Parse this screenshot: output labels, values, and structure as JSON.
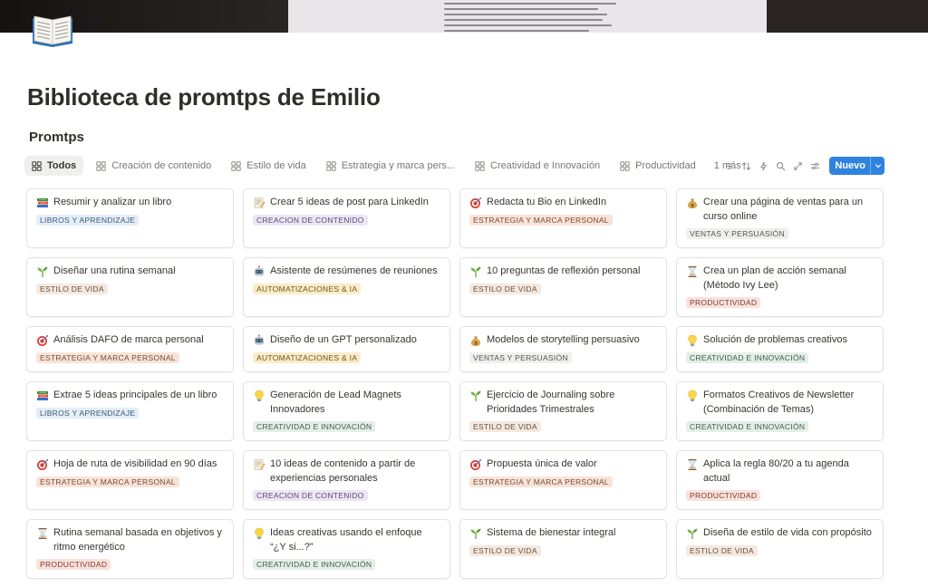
{
  "page": {
    "title": "Biblioteca de promtps de Emilio",
    "icon": "open-book-icon"
  },
  "database": {
    "title": "Promtps"
  },
  "tabs": [
    {
      "label": "Todos",
      "active": true
    },
    {
      "label": "Creación de contenido"
    },
    {
      "label": "Estilo de vida"
    },
    {
      "label": "Estrategia y marca pers..."
    },
    {
      "label": "Creatividad e Innovación"
    },
    {
      "label": "Productividad"
    }
  ],
  "tabs_more": "1 más",
  "toolbar": {
    "icons": [
      "filter-icon",
      "sort-icon",
      "lightning-icon",
      "search-icon",
      "expand-icon",
      "settings-icon"
    ],
    "new_label": "Nuevo",
    "accent": "#2f83de"
  },
  "cards": [
    {
      "emoji": "books-icon",
      "title": "Resumir y analizar un libro",
      "tag": "LIBROS Y APRENDIZAJE",
      "tag_color": "blue"
    },
    {
      "emoji": "memo-icon",
      "title": "Crear 5 ideas de post para LinkedIn",
      "tag": "CREACION DE CONTENIDO",
      "tag_color": "purple"
    },
    {
      "emoji": "target-icon",
      "title": "Redacta tu Bio en LinkedIn",
      "tag": "ESTRATEGIA Y MARCA PERSONAL",
      "tag_color": "orange"
    },
    {
      "emoji": "money-bag-icon",
      "title": "Crear una página de ventas para un curso online",
      "tag": "VENTAS Y PERSUASIÓN",
      "tag_color": "gray"
    },
    {
      "emoji": "seedling-icon",
      "title": "Diseñar una rutina semanal",
      "tag": "ESTILO DE VIDA",
      "tag_color": "brown"
    },
    {
      "emoji": "robot-icon",
      "title": "Asistente de resúmenes de reuniones",
      "tag": "AUTOMATIZACIONES & IA",
      "tag_color": "yellow"
    },
    {
      "emoji": "seedling-icon",
      "title": "10 preguntas de reflexión personal",
      "tag": "ESTILO DE VIDA",
      "tag_color": "brown"
    },
    {
      "emoji": "hourglass-icon",
      "title": "Crea un plan de acción semanal (Método Ivy Lee)",
      "tag": "PRODUCTIVIDAD",
      "tag_color": "red"
    },
    {
      "emoji": "target-icon",
      "title": "Análisis DAFO de marca personal",
      "tag": "ESTRATEGIA Y MARCA PERSONAL",
      "tag_color": "orange"
    },
    {
      "emoji": "robot-icon",
      "title": "Diseño de un GPT personalizado",
      "tag": "AUTOMATIZACIONES & IA",
      "tag_color": "yellow"
    },
    {
      "emoji": "money-bag-icon",
      "title": "Modelos de storytelling persuasivo",
      "tag": "VENTAS Y PERSUASIÓN",
      "tag_color": "gray"
    },
    {
      "emoji": "lightbulb-icon",
      "title": "Solución de problemas creativos",
      "tag": "CREATIVIDAD E INNOVACIÓN",
      "tag_color": "green"
    },
    {
      "emoji": "books-icon",
      "title": "Extrae 5 ideas principales de un libro",
      "tag": "LIBROS Y APRENDIZAJE",
      "tag_color": "blue"
    },
    {
      "emoji": "lightbulb-icon",
      "title": "Generación de Lead Magnets Innovadores",
      "tag": "CREATIVIDAD E INNOVACIÓN",
      "tag_color": "green"
    },
    {
      "emoji": "seedling-icon",
      "title": "Ejercicio de Journaling sobre Prioridades Trimestrales",
      "tag": "ESTILO DE VIDA",
      "tag_color": "brown"
    },
    {
      "emoji": "lightbulb-icon",
      "title": "Formatos Creativos de Newsletter (Combinación de Temas)",
      "tag": "CREATIVIDAD E INNOVACIÓN",
      "tag_color": "green"
    },
    {
      "emoji": "target-icon",
      "title": "Hoja de ruta de visibilidad en 90 días",
      "tag": "ESTRATEGIA Y MARCA PERSONAL",
      "tag_color": "orange"
    },
    {
      "emoji": "memo-icon",
      "title": "10 ideas de contenido a partir de experiencias personales",
      "tag": "CREACION DE CONTENIDO",
      "tag_color": "purple"
    },
    {
      "emoji": "target-icon",
      "title": "Propuesta única de valor",
      "tag": "ESTRATEGIA Y MARCA PERSONAL",
      "tag_color": "orange"
    },
    {
      "emoji": "hourglass-icon",
      "title": "Aplica la regla 80/20 a tu agenda actual",
      "tag": "PRODUCTIVIDAD",
      "tag_color": "red"
    },
    {
      "emoji": "hourglass-icon",
      "title": "Rutina semanal basada en objetivos y ritmo energético",
      "tag": "PRODUCTIVIDAD",
      "tag_color": "red"
    },
    {
      "emoji": "lightbulb-icon",
      "title": "Ideas creativas usando el enfoque “¿Y si...?”",
      "tag": "CREATIVIDAD E INNOVACIÓN",
      "tag_color": "green"
    },
    {
      "emoji": "seedling-icon",
      "title": "Sistema de bienestar integral",
      "tag": "ESTILO DE VIDA",
      "tag_color": "brown"
    },
    {
      "emoji": "seedling-icon",
      "title": "Diseña de estilo de vida con propósito",
      "tag": "ESTILO DE VIDA",
      "tag_color": "brown"
    }
  ]
}
